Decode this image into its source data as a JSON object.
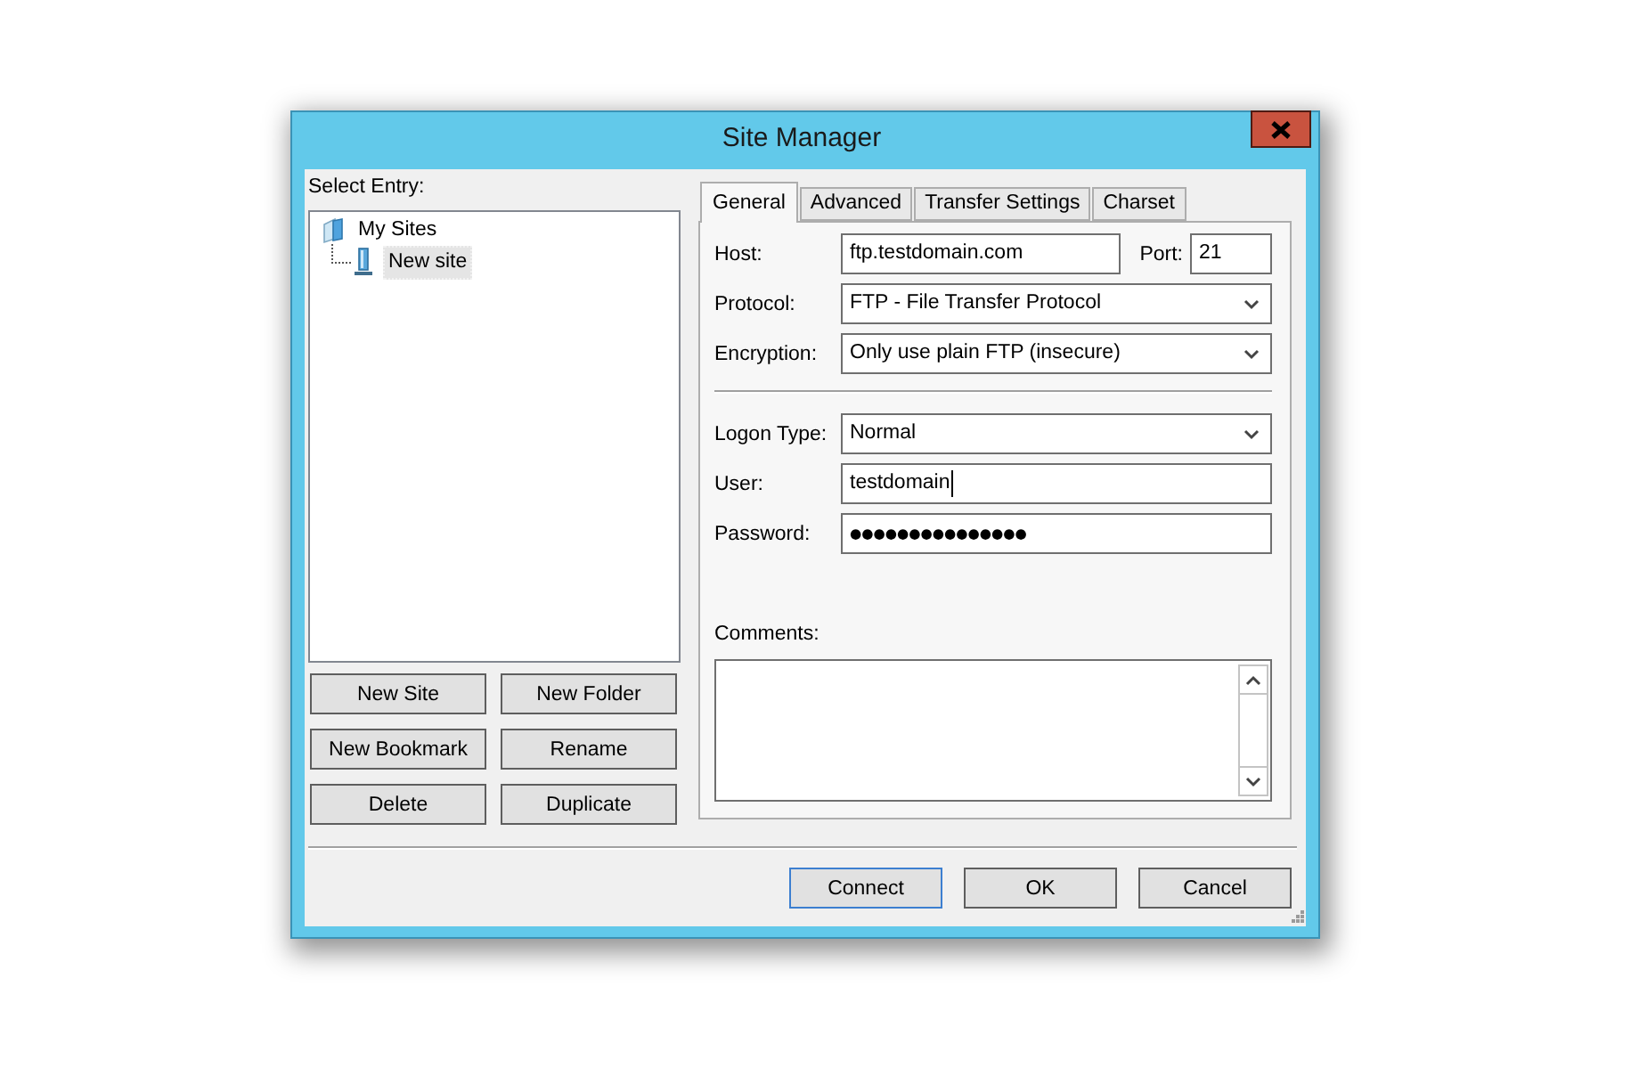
{
  "window": {
    "title": "Site Manager"
  },
  "select_entry": {
    "label": "Select Entry:"
  },
  "tree": [
    {
      "kind": "folder",
      "label": "My Sites",
      "selected": false,
      "children": [
        {
          "kind": "site",
          "label": "New site",
          "selected": true
        }
      ]
    }
  ],
  "entry_buttons": [
    "New Site",
    "New Folder",
    "New Bookmark",
    "Rename",
    "Delete",
    "Duplicate"
  ],
  "tabs": [
    {
      "label": "General",
      "selected": true
    },
    {
      "label": "Advanced",
      "selected": false
    },
    {
      "label": "Transfer Settings",
      "selected": false
    },
    {
      "label": "Charset",
      "selected": false
    }
  ],
  "general": {
    "host": {
      "label": "Host:",
      "value": "ftp.testdomain.com"
    },
    "port": {
      "label": "Port:",
      "value": "21"
    },
    "connection_fields": [
      {
        "kind": "select",
        "label": "Protocol:",
        "value": "FTP - File Transfer Protocol"
      },
      {
        "kind": "select",
        "label": "Encryption:",
        "value": "Only use plain FTP (insecure)"
      }
    ],
    "login_fields": [
      {
        "kind": "select",
        "label": "Logon Type:",
        "value": "Normal",
        "focused": false
      },
      {
        "kind": "text",
        "label": "User:",
        "value": "testdomain",
        "focused": true
      },
      {
        "kind": "password",
        "label": "Password:",
        "value": "●●●●●●●●●●●●●●●",
        "focused": false
      }
    ],
    "comments": {
      "label": "Comments:"
    }
  },
  "dialog_buttons": [
    {
      "label": "Connect",
      "default": true
    },
    {
      "label": "OK",
      "default": false
    },
    {
      "label": "Cancel",
      "default": false
    }
  ]
}
